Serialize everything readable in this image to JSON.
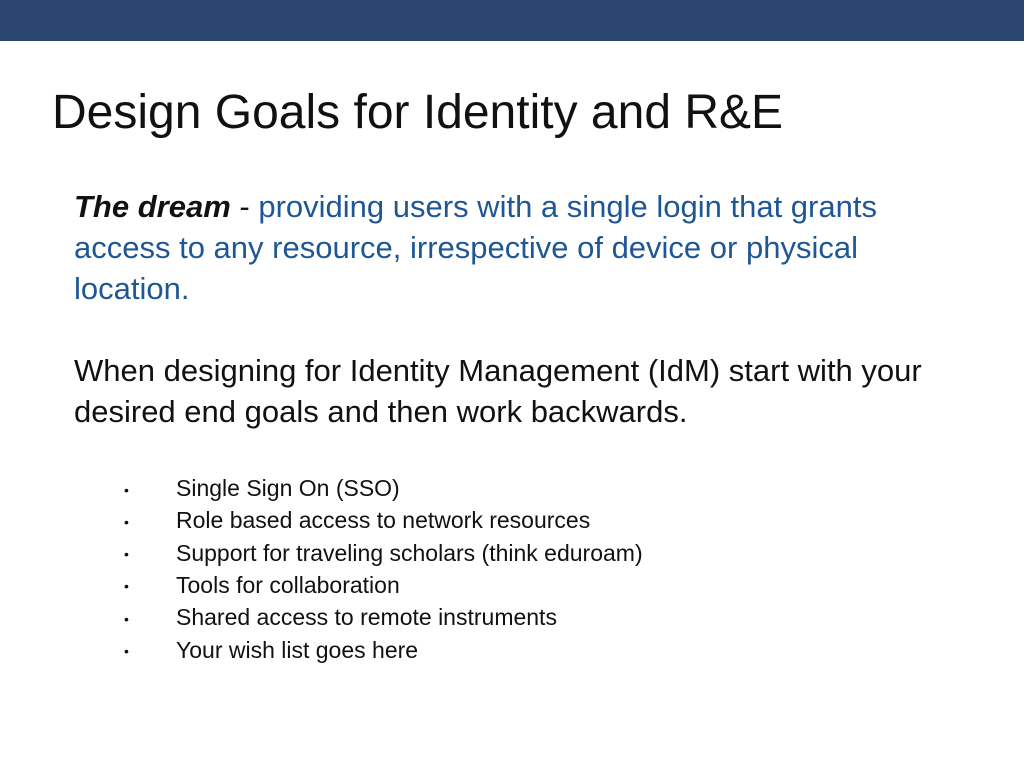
{
  "slide": {
    "title": "Design Goals for Identity and R&E",
    "dream": {
      "lead": "The dream",
      "separator": " - ",
      "text": "providing users with a single login that grants access to any resource, irrespective of device or physical location."
    },
    "idm_paragraph": "When designing for Identity Management (IdM) start with your desired end goals and then work backwards.",
    "bullet_glyph": "•",
    "goals": [
      "Single Sign On (SSO)",
      "Role based access to network resources",
      "Support for traveling scholars (think eduroam)",
      "Tools for collaboration",
      "Shared access to remote instruments",
      "Your wish list goes here"
    ]
  },
  "colors": {
    "top_band": "#2a4670",
    "accent_text": "#1f5794",
    "body_text": "#111111"
  }
}
